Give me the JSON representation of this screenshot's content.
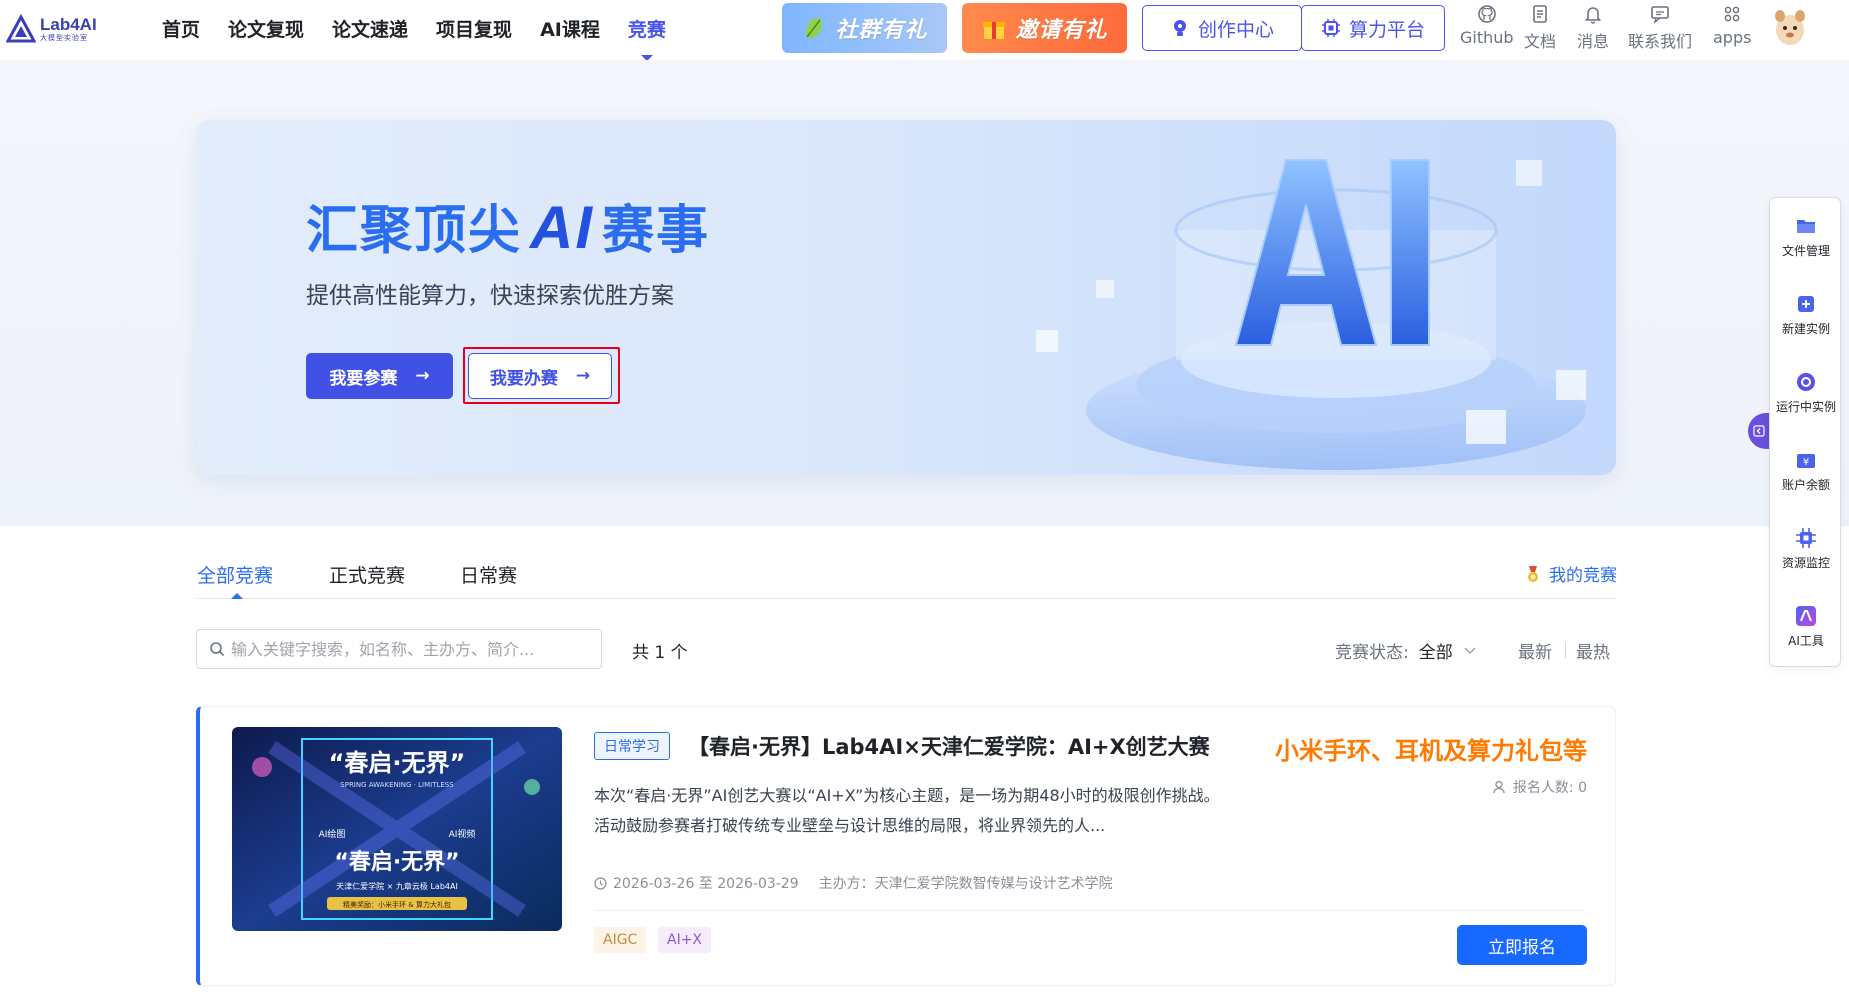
{
  "brand": {
    "name": "Lab4AI",
    "subtitle": "大模型实验室"
  },
  "nav": {
    "items": [
      {
        "label": "首页",
        "active": false
      },
      {
        "label": "论文复现",
        "active": false
      },
      {
        "label": "论文速递",
        "active": false
      },
      {
        "label": "项目复现",
        "active": false
      },
      {
        "label": "AI课程",
        "active": false
      },
      {
        "label": "竞赛",
        "active": true
      }
    ]
  },
  "promos": {
    "community": "社群有礼",
    "invite": "邀请有礼"
  },
  "actions": {
    "create_center": "创作中心",
    "compute_platform": "算力平台"
  },
  "utilities": [
    {
      "label": "Github",
      "icon": "github-icon"
    },
    {
      "label": "文档",
      "icon": "document-icon"
    },
    {
      "label": "消息",
      "icon": "bell-icon"
    },
    {
      "label": "联系我们",
      "icon": "chat-icon"
    },
    {
      "label": "apps",
      "icon": "apps-grid-icon"
    }
  ],
  "hero": {
    "title_before": "汇聚顶尖",
    "title_ai": "AI",
    "title_after": "赛事",
    "subtitle": "提供高性能算力，快速探索优胜方案",
    "join_label": "我要参赛",
    "host_label": "我要办赛",
    "arrow": "→"
  },
  "tabs": {
    "items": [
      {
        "label": "全部竞赛",
        "active": true
      },
      {
        "label": "正式竞赛",
        "active": false
      },
      {
        "label": "日常赛",
        "active": false
      }
    ],
    "my_contest": "我的竞赛"
  },
  "filters": {
    "search_placeholder": "输入关键字搜索，如名称、主办方、简介...",
    "total": "共 1 个",
    "status_label": "竞赛状态:",
    "status_value": "全部",
    "sort_latest": "最新",
    "sort_hot": "最热"
  },
  "contest": {
    "tag": "日常学习",
    "title": "【春启·无界】Lab4AI×天津仁爱学院：AI+X创艺大赛",
    "prize": "小米手环、耳机及算力礼包等",
    "enroll_count": "报名人数: 0",
    "description": "本次“春启·无界”AI创艺大赛以“AI+X”为核心主题，是一场为期48小时的极限创作挑战。活动鼓励参赛者打破传统专业壁垒与设计思维的局限，将业界领先的人...",
    "date_range": "2026-03-26 至 2026-03-29",
    "organizer": "主办方：天津仁爱学院数智传媒与设计艺术学院",
    "chips": [
      "AIGC",
      "AI+X"
    ],
    "enroll_button": "立即报名",
    "poster": {
      "title_top": "“春启·无界”",
      "subtitle": "SPRING AWAKENING · LIMITLESS",
      "title_bottom": "“春启·无界”",
      "side_left": "AI绘图",
      "side_right": "AI视频",
      "footer": "天津仁爱学院 × 九章云极 Lab4AI",
      "prize_strip": "精美奖励：小米手环 & 算力大礼包"
    }
  },
  "sidebar": [
    {
      "label": "文件管理",
      "icon": "folder-icon"
    },
    {
      "label": "新建实例",
      "icon": "add-instance-icon"
    },
    {
      "label": "运行中实例",
      "icon": "running-instance-icon"
    },
    {
      "label": "账户余额",
      "icon": "wallet-icon"
    },
    {
      "label": "资源监控",
      "icon": "chip-monitor-icon"
    },
    {
      "label": "AI工具",
      "icon": "ai-tool-icon"
    }
  ],
  "colors": {
    "primary": "#4a54e8",
    "link": "#2a6df0",
    "prize": "#ff7a00",
    "highlight": "#e3001b"
  }
}
